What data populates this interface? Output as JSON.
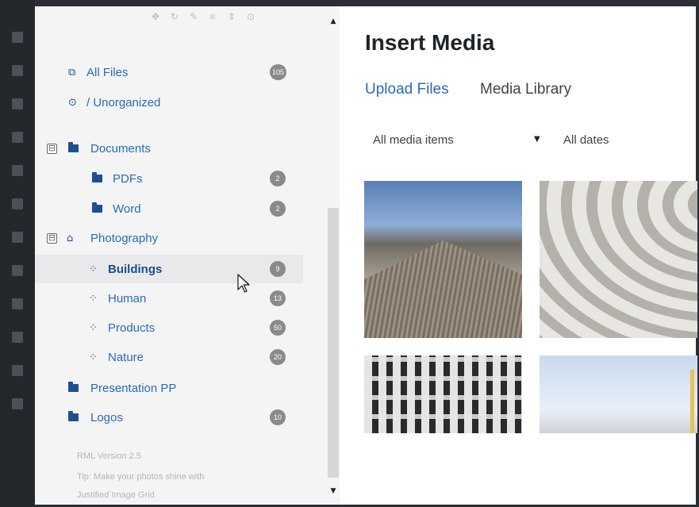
{
  "sidebar": {
    "toolbar_icons": [
      "move-icon",
      "refresh-icon",
      "edit-icon",
      "list-icon",
      "sort-icon",
      "settings-icon"
    ],
    "all_files": {
      "label": "All Files",
      "count": "105"
    },
    "unorganized": {
      "label": "/ Unorganized"
    },
    "folders": {
      "documents": {
        "label": "Documents",
        "toggle": "⊟"
      },
      "pdfs": {
        "label": "PDFs",
        "count": "2"
      },
      "word": {
        "label": "Word",
        "count": "2"
      },
      "photography": {
        "label": "Photography",
        "toggle": "⊟"
      },
      "buildings": {
        "label": "Buildings",
        "count": "9"
      },
      "human": {
        "label": "Human",
        "count": "13"
      },
      "products": {
        "label": "Products",
        "count": "50"
      },
      "nature": {
        "label": "Nature",
        "count": "20"
      },
      "presentation": {
        "label": "Presentation PP"
      },
      "logos": {
        "label": "Logos",
        "count": "10"
      }
    },
    "footer": {
      "version": "RML Version 2.5",
      "tip_line1": "Tip: Make your photos shine with",
      "tip_line2": "Justified Image Grid"
    }
  },
  "main": {
    "title": "Insert Media",
    "tabs": {
      "upload": "Upload Files",
      "library": "Media Library"
    },
    "filters": {
      "type": "All media items",
      "dates": "All dates"
    }
  },
  "colors": {
    "accent": "#2a6bb8",
    "folder": "#1d4f91",
    "badge": "#8a8a8a",
    "admin_bar": "#23282d"
  }
}
